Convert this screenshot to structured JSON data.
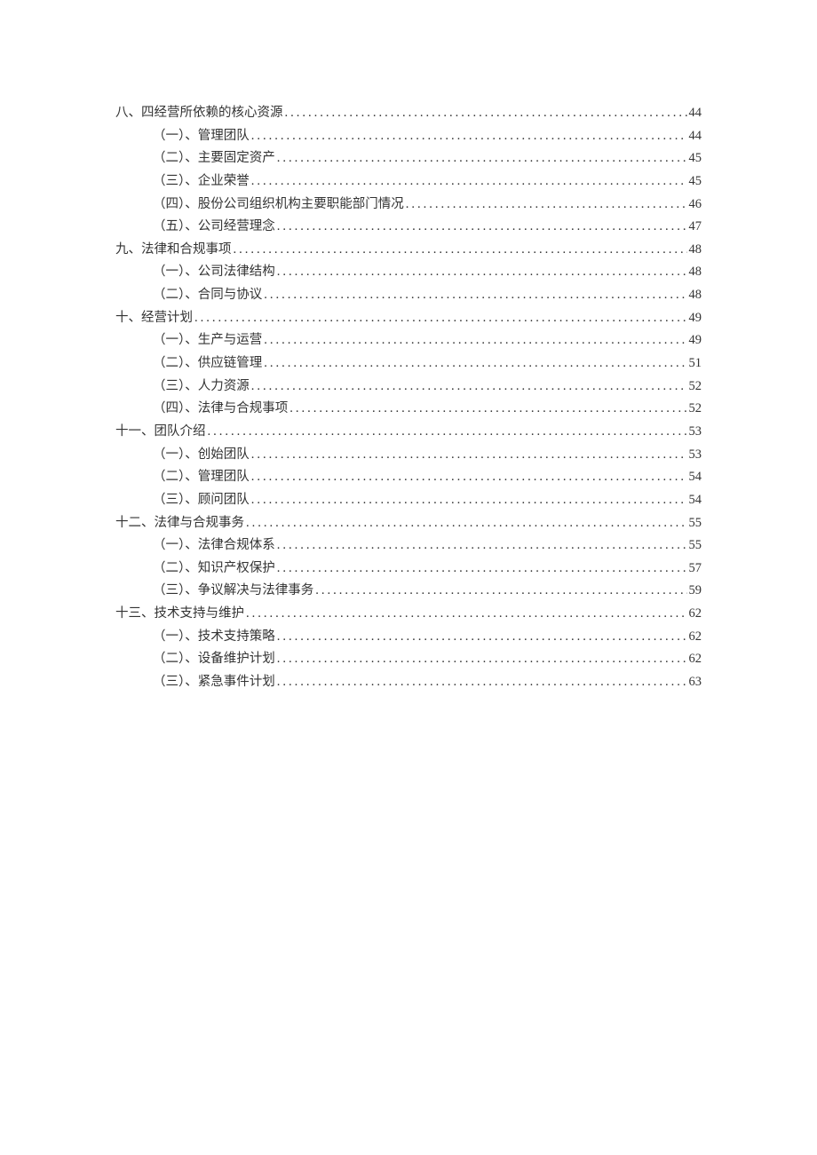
{
  "toc": [
    {
      "level": 1,
      "label": "八、四经营所依赖的核心资源",
      "page": "44"
    },
    {
      "level": 2,
      "label": "（一）、管理团队",
      "page": "44"
    },
    {
      "level": 2,
      "label": "（二）、主要固定资产",
      "page": "45"
    },
    {
      "level": 2,
      "label": "（三）、企业荣誉",
      "page": "45"
    },
    {
      "level": 2,
      "label": "（四）、股份公司组织机构主要职能部门情况",
      "page": "46"
    },
    {
      "level": 2,
      "label": "（五）、公司经营理念",
      "page": "47"
    },
    {
      "level": 1,
      "label": "九、法律和合规事项",
      "page": "48"
    },
    {
      "level": 2,
      "label": "（一）、公司法律结构",
      "page": "48"
    },
    {
      "level": 2,
      "label": "（二）、合同与协议",
      "page": "48"
    },
    {
      "level": 1,
      "label": "十、经营计划",
      "page": "49"
    },
    {
      "level": 2,
      "label": "（一）、生产与运营",
      "page": "49"
    },
    {
      "level": 2,
      "label": "（二）、供应链管理",
      "page": "51"
    },
    {
      "level": 2,
      "label": "（三）、人力资源",
      "page": "52"
    },
    {
      "level": 2,
      "label": "（四）、法律与合规事项",
      "page": "52"
    },
    {
      "level": 1,
      "label": "十一、团队介绍",
      "page": "53"
    },
    {
      "level": 2,
      "label": "（一）、创始团队",
      "page": "53"
    },
    {
      "level": 2,
      "label": "（二）、管理团队",
      "page": "54"
    },
    {
      "level": 2,
      "label": "（三）、顾问团队",
      "page": "54"
    },
    {
      "level": 1,
      "label": "十二、法律与合规事务",
      "page": "55"
    },
    {
      "level": 2,
      "label": "（一）、法律合规体系",
      "page": "55"
    },
    {
      "level": 2,
      "label": "（二）、知识产权保护",
      "page": "57"
    },
    {
      "level": 2,
      "label": "（三）、争议解决与法律事务",
      "page": "59"
    },
    {
      "level": 1,
      "label": "十三、技术支持与维护",
      "page": "62"
    },
    {
      "level": 2,
      "label": "（一）、技术支持策略",
      "page": "62"
    },
    {
      "level": 2,
      "label": "（二）、设备维护计划",
      "page": "62"
    },
    {
      "level": 2,
      "label": "（三）、紧急事件计划",
      "page": "63"
    }
  ]
}
